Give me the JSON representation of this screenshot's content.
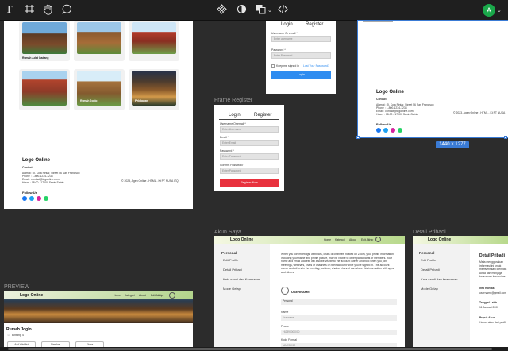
{
  "toolbar": {
    "text_tool_icon": "text-icon",
    "frame_tool_icon": "frame-icon",
    "hand_tool_icon": "hand-icon",
    "comment_tool_icon": "comment-icon",
    "component_icon": "component-icon",
    "contrast_icon": "contrast-icon",
    "boolean_icon": "boolean-icon",
    "code_icon": "code-icon",
    "avatar_initial": "A"
  },
  "frames": {
    "register_label": "Frame Register",
    "akun_label": "Akun Saya",
    "pribadi_label": "Detail Pribadi",
    "preview_label": "PREVIEW",
    "dimension_badge": "1440 × 1277"
  },
  "home_frame": {
    "captions": [
      "Rumah Adat Gadang",
      "",
      "",
      "",
      "Rumah Joglo",
      "Pelebaran"
    ],
    "logo": "Logo Online",
    "contact_heading": "Contact",
    "address": "Alamat : Jl. Kota Pintar, Street 56 San Francisco",
    "phone": "Phone : 1-800-1234-1234",
    "email": "Email : contact@logonline.com",
    "hours": "Hours : 08:00 - 17:00, Senin-Sabtu",
    "copyright": "© 2023, Agen Online - HTML - Kt PT NUSA ITQ",
    "follow": "Follow Us"
  },
  "login_frame": {
    "tab_login": "Login",
    "tab_register": "Register",
    "username_label": "Username Or email *",
    "username_placeholder": "Enter username",
    "password_label": "Password *",
    "password_placeholder": "Enter Password",
    "keep_signed": "Keep me signed in",
    "lost_password": "Lost Your Password?",
    "login_button": "Login"
  },
  "register_frame": {
    "tab_login": "Login",
    "tab_register": "Register",
    "username_label": "Username Or email *",
    "username_placeholder": "Enter Username",
    "email_label": "Email *",
    "email_placeholder": "Enter Email",
    "password_label": "Password *",
    "password_placeholder": "Enter Password",
    "confirm_label": "Confirm Password *",
    "confirm_placeholder": "Enter Password",
    "register_button": "Register Now"
  },
  "right_frame": {
    "logo": "Logo Online",
    "contact_heading": "Contact",
    "address": "Alamat : Jl. Kota Pintar, Street 56 San Francisco",
    "phone": "Phone : 1-800-1234-1234",
    "email": "Email : contact@logonline.com",
    "hours": "Hours : 08:00 - 17:00, Senin-Sabtu",
    "copyright": "© 2023, Agen Online - HTML - Kt PT NUSA",
    "follow": "Follow Us"
  },
  "akun_frame": {
    "logo": "Logo Online",
    "nav": [
      "Home",
      "Kategori",
      "About",
      "Edit Akhtp"
    ],
    "side_heading": "Personal",
    "side_items": [
      "Edit Profile",
      "Detail Pribadi",
      "Kata sandi dan Keamanan",
      "Mode Gelap"
    ],
    "intro": "When you join meetings, webinars, chats or channels hosted on Zoom, your profile information, including your name and profile picture, may be visible to other participants or members. Your name and email address will also be visible to the account owner and host when you join meetings, webinars, chats or channels on their account while you're signed in. The account owner and others in the meeting, webinar, chat or channel can share this information with apps and others.",
    "username": "USERNAME",
    "personal": "Personal",
    "name_label": "Name",
    "name_value": "Username",
    "phone_label": "Phone",
    "phone_value": "+62890000000",
    "kode_label": "Kode Formal",
    "kode_value": "MARS2010"
  },
  "pribadi_frame": {
    "logo": "Logo Online",
    "side_heading": "Personal",
    "side_items": [
      "Edit Profile",
      "Detail Pribadi",
      "Kata sandi dan keamanan",
      "Mode Gelap"
    ],
    "title": "Detail Pribadi",
    "intro": "Meta menggunakan informasi ini untuk memverifikasi identitas Anda dan menjaga keamanan komunitas. Anda dapat memilih detail pribadi mana yang terlihat oleh orang lain.",
    "info_kontak": "Info Kontak",
    "info_kontak_value": "username@gmail.com",
    "tgl_lahir": "Tanggal Lahir",
    "tgl_lahir_value": "11 Januari 2000",
    "pupuk": "Pupuk Akun",
    "pupuk_value": "Hapus akun dari profil"
  },
  "preview_frame": {
    "logo": "Logo Online",
    "nav": [
      "Home",
      "Kategori",
      "About",
      "Edit Akhtp"
    ],
    "title": "Rumah Joglo",
    "rating": "Bintang 4",
    "buttons": [
      "Add Wishlist",
      "Simulasi",
      "Share"
    ]
  }
}
